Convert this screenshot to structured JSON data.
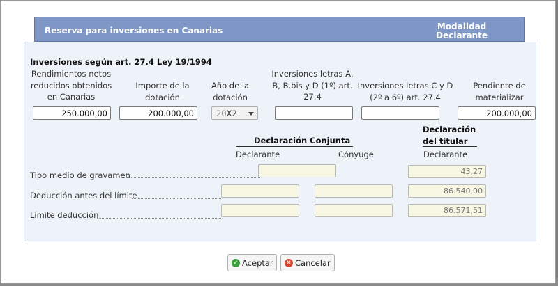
{
  "dialog": {
    "header_title": "Reserva para inversiones en Canarias",
    "header_mod_line1": "Modalidad",
    "header_mod_line2": "Declarante"
  },
  "section_title": "Inversiones según art. 27.4 Ley 19/1994",
  "columns": {
    "col1_line1": "Rendimientos netos",
    "col1_line2": "reducidos obtenidos",
    "col1_line3": "en Canarias",
    "col2_line1": "Importe de la",
    "col2_line2": "dotación",
    "col3_line1": "Año de la",
    "col3_line2": "dotación",
    "col4_line1": "Inversiones letras A,",
    "col4_line2": "B, B.bis y D (1º) art.",
    "col4_line3": "27.4",
    "col5_line1": "Inversiones letras C y D",
    "col5_line2": "(2º a 6º) art. 27.4",
    "col6_line1": "Pendiente de",
    "col6_line2": "materializar"
  },
  "inputs": {
    "rendimientos": "250.000,00",
    "importe": "200.000,00",
    "anio_prefix": "20",
    "anio_value": "X2",
    "inv_ab": "",
    "inv_cd": "",
    "pendiente": "200.000,00"
  },
  "table": {
    "conjunta_label": "Declaración Conjunta",
    "titular_line1": "Declaración",
    "titular_line2": "del titular",
    "sub_declarante": "Declarante",
    "sub_conyuge": "Cónyuge",
    "sub_declarante2": "Declarante",
    "rows": [
      {
        "label": "Tipo medio de gravamen",
        "conj": "",
        "cony": "",
        "titular": "43,27"
      },
      {
        "label": "Deducción antes del límite",
        "conj": "",
        "cony": "",
        "titular": "86.540,00"
      },
      {
        "label": "Límite deducción",
        "conj": "",
        "cony": "",
        "titular": "86.571,51"
      }
    ]
  },
  "buttons": {
    "accept": "Aceptar",
    "cancel": "Cancelar",
    "accept_icon": "check-circle-icon",
    "cancel_icon": "cancel-circle-icon"
  },
  "colors": {
    "header_bg": "#7e97c6",
    "panel_bg": "#eef3f9",
    "readonly_bg": "#f7f7e4"
  }
}
